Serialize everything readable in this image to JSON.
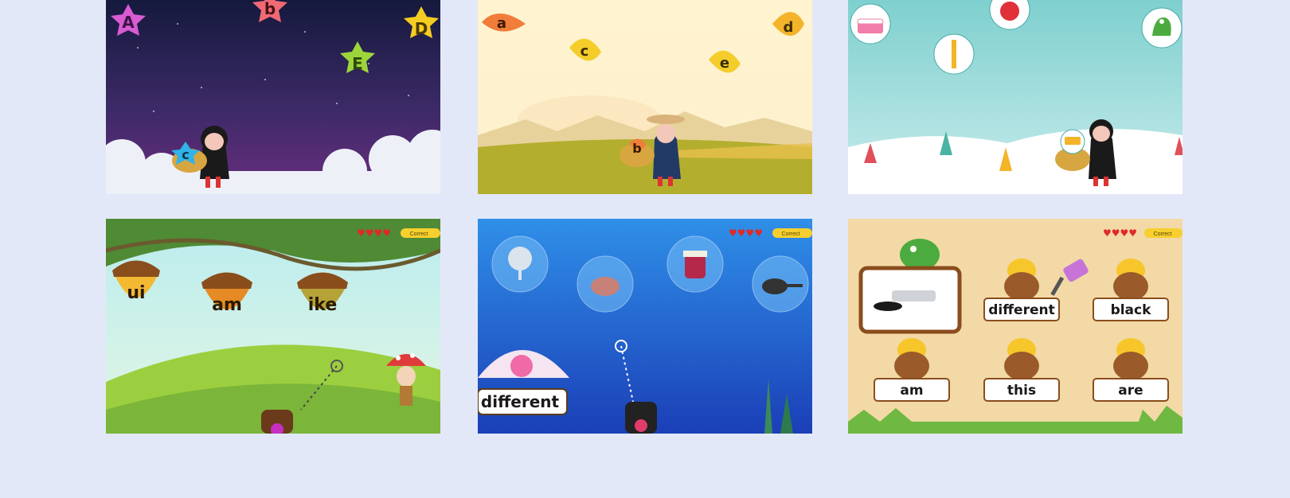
{
  "games": [
    {
      "letters": [
        "A",
        "b",
        "D",
        "E",
        "c"
      ]
    },
    {
      "letters": [
        "a",
        "c",
        "d",
        "e",
        "b"
      ]
    },
    {
      "icons": [
        "cake-icon",
        "candle-icon",
        "apple-icon",
        "crocodile-icon",
        "bus-icon"
      ]
    },
    {
      "words": [
        "ui",
        "am",
        "ike"
      ],
      "status": "Correct",
      "hearts": 4
    },
    {
      "word": "different",
      "status": "Correct",
      "hearts": 4,
      "items": [
        "fan-icon",
        "ham-icon",
        "jam-jar-icon",
        "frying-pan-icon"
      ]
    },
    {
      "words": [
        "different",
        "black",
        "am",
        "this",
        "are"
      ],
      "status": "Correct",
      "hearts": 4,
      "card_icon": "paint-tube-icon"
    }
  ]
}
